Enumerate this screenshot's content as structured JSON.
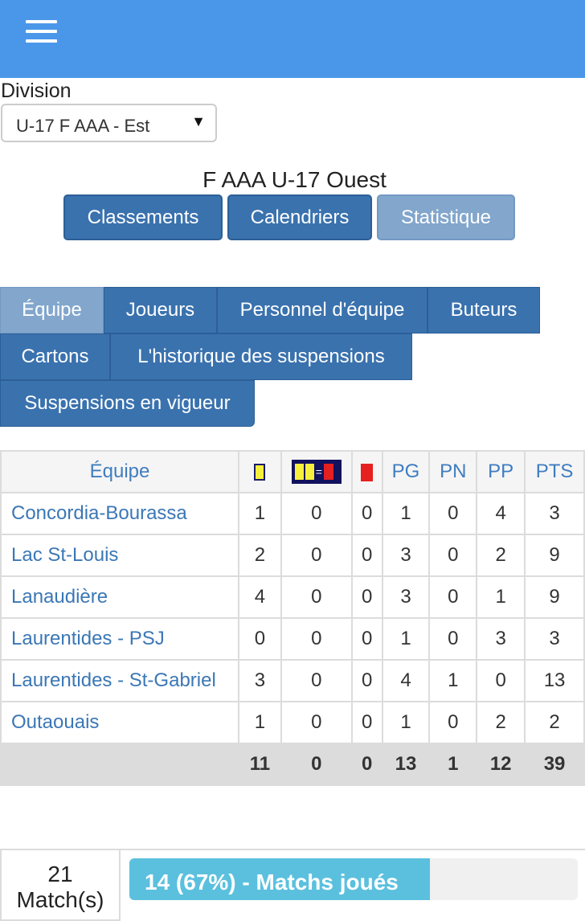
{
  "header": {
    "menu_icon": "hamburger-menu-icon",
    "color": "#4a97ea"
  },
  "division": {
    "label": "Division",
    "selected": "U-17 F AAA - Est",
    "arrow_glyph": "▼"
  },
  "page_title": "F AAA U-17 Ouest",
  "main_buttons": [
    {
      "label": "Classements",
      "active": false
    },
    {
      "label": "Calendriers",
      "active": false
    },
    {
      "label": "Statistique",
      "active": true
    }
  ],
  "tabs": [
    {
      "label": "Équipe",
      "active": true
    },
    {
      "label": "Joueurs",
      "active": false
    },
    {
      "label": "Personnel d'équipe",
      "active": false
    },
    {
      "label": "Buteurs",
      "active": false
    },
    {
      "label": "Cartons",
      "active": false
    },
    {
      "label": "L'historique des suspensions",
      "active": false
    },
    {
      "label": "Suspensions en vigueur",
      "active": false
    }
  ],
  "stats_table": {
    "headers": {
      "team": "Équipe",
      "yellow": "yellow-card-icon",
      "two_yellow": "two-yellow-equals-red-icon",
      "two_yellow_eq": "=",
      "red": "red-card-icon",
      "pg": "PG",
      "pn": "PN",
      "pp": "PP",
      "pts": "PTS"
    },
    "rows": [
      {
        "team": "Concordia-Bourassa",
        "yellow": "1",
        "two_yellow": "0",
        "red": "0",
        "pg": "1",
        "pn": "0",
        "pp": "4",
        "pts": "3"
      },
      {
        "team": "Lac St-Louis",
        "yellow": "2",
        "two_yellow": "0",
        "red": "0",
        "pg": "3",
        "pn": "0",
        "pp": "2",
        "pts": "9"
      },
      {
        "team": "Lanaudière",
        "yellow": "4",
        "two_yellow": "0",
        "red": "0",
        "pg": "3",
        "pn": "0",
        "pp": "1",
        "pts": "9"
      },
      {
        "team": "Laurentides - PSJ",
        "yellow": "0",
        "two_yellow": "0",
        "red": "0",
        "pg": "1",
        "pn": "0",
        "pp": "3",
        "pts": "3"
      },
      {
        "team": "Laurentides - St-Gabriel",
        "yellow": "3",
        "two_yellow": "0",
        "red": "0",
        "pg": "4",
        "pn": "1",
        "pp": "0",
        "pts": "13"
      },
      {
        "team": "Outaouais",
        "yellow": "1",
        "two_yellow": "0",
        "red": "0",
        "pg": "1",
        "pn": "0",
        "pp": "2",
        "pts": "2"
      }
    ],
    "totals": {
      "yellow": "11",
      "two_yellow": "0",
      "red": "0",
      "pg": "13",
      "pn": "1",
      "pp": "12",
      "pts": "39"
    }
  },
  "matches": {
    "count": "21",
    "count_label": "Match(s)",
    "progress_text": "14 (67%) - Matchs joués",
    "progress_fraction": 0.67,
    "progress_color": "#5bc0de"
  }
}
